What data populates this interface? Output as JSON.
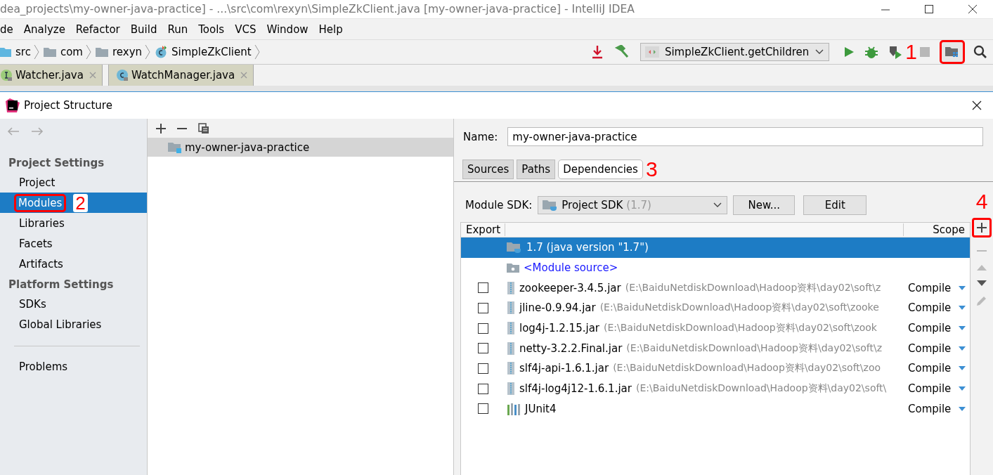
{
  "window": {
    "title": "dea_projects\\my-owner-java-practice] - ...\\src\\com\\rexyn\\SimpleZkClient.java [my-owner-java-practice] - IntelliJ IDEA"
  },
  "menu": [
    "de",
    "Analyze",
    "Refactor",
    "Build",
    "Run",
    "Tools",
    "VCS",
    "Window",
    "Help"
  ],
  "breadcrumbs": [
    {
      "label": "src",
      "kind": "source-folder"
    },
    {
      "label": "com",
      "kind": "folder"
    },
    {
      "label": "rexyn",
      "kind": "folder"
    },
    {
      "label": "SimpleZkClient",
      "kind": "class"
    }
  ],
  "toolbar": {
    "run_config": "SimpleZkClient.getChildren",
    "callout": "1"
  },
  "editor_tabs": [
    {
      "label": "Watcher.java",
      "kind": "interface"
    },
    {
      "label": "WatchManager.java",
      "kind": "class"
    }
  ],
  "dialog": {
    "title": "Project Structure",
    "sidebar": [
      {
        "heading": "Project Settings",
        "items": [
          {
            "label": "Project",
            "selected": false
          },
          {
            "label": "Modules",
            "selected": true,
            "callout": "2"
          },
          {
            "label": "Libraries",
            "selected": false
          },
          {
            "label": "Facets",
            "selected": false
          },
          {
            "label": "Artifacts",
            "selected": false
          }
        ]
      },
      {
        "heading": "Platform Settings",
        "items": [
          {
            "label": "SDKs",
            "selected": false
          },
          {
            "label": "Global Libraries",
            "selected": false
          }
        ]
      },
      {
        "items": [
          {
            "label": "Problems",
            "selected": false
          }
        ]
      }
    ],
    "modules": [
      {
        "label": "my-owner-java-practice",
        "selected": true
      }
    ],
    "name_label": "Name:",
    "name_value": "my-owner-java-practice",
    "tabs": [
      {
        "label": "Sources",
        "selected": false
      },
      {
        "label": "Paths",
        "selected": false
      },
      {
        "label": "Dependencies",
        "selected": true,
        "callout": "3"
      }
    ],
    "sdk_label": "Module SDK:",
    "sdk_value": "Project SDK",
    "sdk_version": "(1.7)",
    "buttons": [
      "New...",
      "Edit"
    ],
    "columns": [
      "Export",
      "Scope"
    ],
    "add_callout": "4",
    "dependencies": [
      {
        "kind": "sdk",
        "name": "1.7 (java version \"1.7\")",
        "selected": true
      },
      {
        "kind": "source",
        "name": "<Module source>",
        "selected": false
      },
      {
        "kind": "jar",
        "name": "zookeeper-3.4.5.jar",
        "path": "(E:\\BaiduNetdiskDownload\\Hadoop资料\\day02\\soft\\z",
        "scope": "Compile",
        "exported": false,
        "selected": false
      },
      {
        "kind": "jar",
        "name": "jline-0.9.94.jar",
        "path": "(E:\\BaiduNetdiskDownload\\Hadoop资料\\day02\\soft\\zooke",
        "scope": "Compile",
        "exported": false,
        "selected": false
      },
      {
        "kind": "jar",
        "name": "log4j-1.2.15.jar",
        "path": "(E:\\BaiduNetdiskDownload\\Hadoop资料\\day02\\soft\\zook",
        "scope": "Compile",
        "exported": false,
        "selected": false
      },
      {
        "kind": "jar",
        "name": "netty-3.2.2.Final.jar",
        "path": "(E:\\BaiduNetdiskDownload\\Hadoop资料\\day02\\soft\\z",
        "scope": "Compile",
        "exported": false,
        "selected": false
      },
      {
        "kind": "jar",
        "name": "slf4j-api-1.6.1.jar",
        "path": "(E:\\BaiduNetdiskDownload\\Hadoop资料\\day02\\soft\\zoo",
        "scope": "Compile",
        "exported": false,
        "selected": false
      },
      {
        "kind": "jar",
        "name": "slf4j-log4j12-1.6.1.jar",
        "path": "(E:\\BaiduNetdiskDownload\\Hadoop资料\\day02\\soft\\",
        "scope": "Compile",
        "exported": false,
        "selected": false
      },
      {
        "kind": "library",
        "name": "JUnit4",
        "scope": "Compile",
        "exported": false,
        "selected": false
      }
    ]
  }
}
